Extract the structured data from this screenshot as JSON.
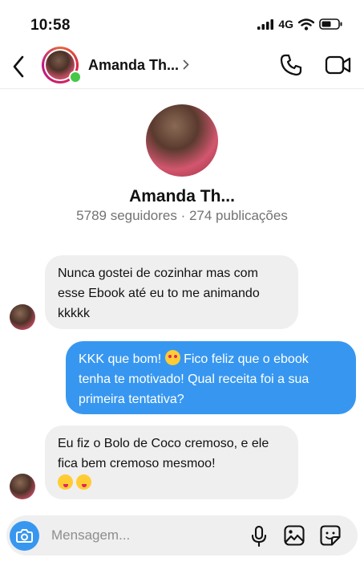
{
  "status_bar": {
    "time": "10:58",
    "network": "4G"
  },
  "header": {
    "name": "Amanda Th..."
  },
  "profile": {
    "name": "Amanda Th...",
    "stats": "5789 seguidores · 274 publicações"
  },
  "messages": [
    {
      "from": "them",
      "text": "Nunca gostei de cozinhar mas com esse Ebook até eu to me animando kkkkk"
    },
    {
      "from": "me",
      "text_part1": "KKK que bom! ",
      "text_part2": " Fico feliz que o ebook tenha te motivado! Qual receita foi a sua primeira tentativa?"
    },
    {
      "from": "them",
      "text": "Eu fiz o Bolo de Coco cremoso, e ele fica bem cremoso mesmoo!"
    }
  ],
  "composer": {
    "placeholder": "Mensagem..."
  },
  "icons": {
    "back": "chevron-left-icon",
    "call": "phone-icon",
    "video": "video-camera-icon",
    "camera": "camera-icon",
    "mic": "microphone-icon",
    "gallery": "image-icon",
    "sticker": "sticker-icon"
  }
}
